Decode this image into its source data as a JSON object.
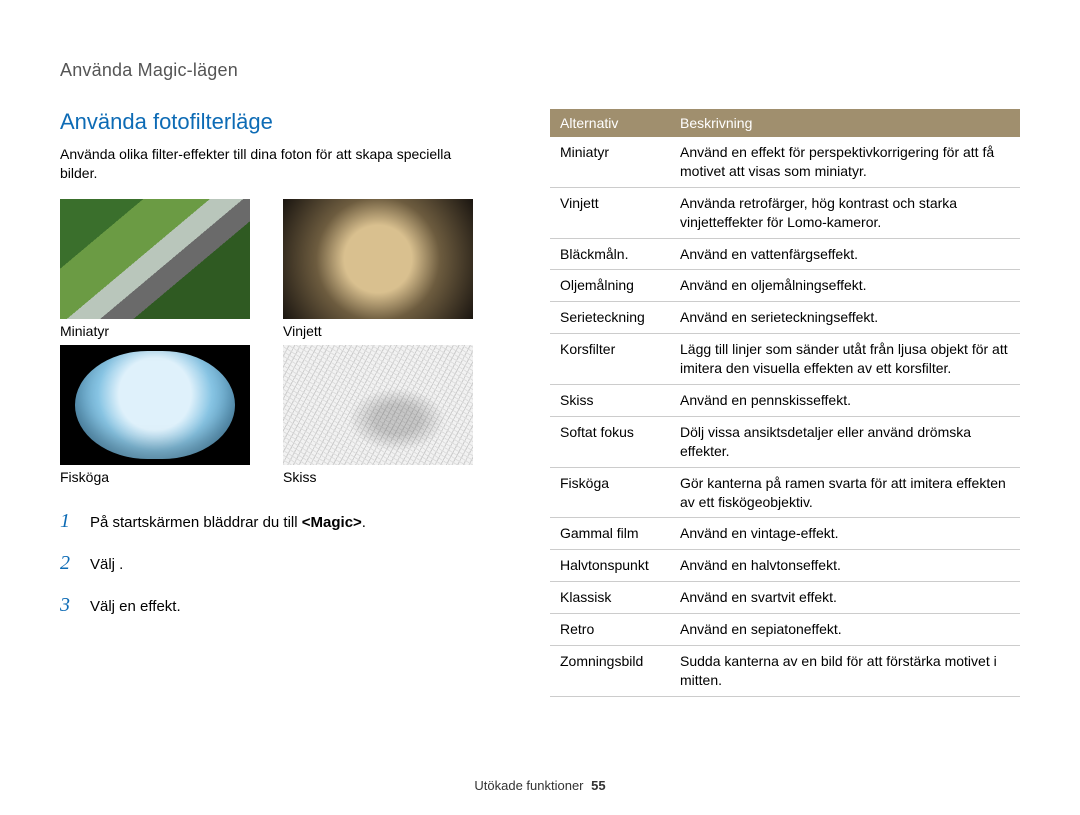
{
  "header": {
    "section": "Använda Magic-lägen"
  },
  "title": "Använda fotofilterläge",
  "intro": "Använda olika filter-effekter till dina foton för att skapa speciella bilder.",
  "thumbnails": [
    {
      "label": "Miniatyr"
    },
    {
      "label": "Vinjett"
    },
    {
      "label": "Fisköga"
    },
    {
      "label": "Skiss"
    }
  ],
  "steps": [
    {
      "num": "1",
      "prefix": "På startskärmen bläddrar du till ",
      "bold": "<Magic>",
      "suffix": "."
    },
    {
      "num": "2",
      "prefix": "Välj",
      "bold": "",
      "suffix": " ."
    },
    {
      "num": "3",
      "prefix": "Välj en effekt.",
      "bold": "",
      "suffix": ""
    }
  ],
  "table": {
    "headers": {
      "col1": "Alternativ",
      "col2": "Beskrivning"
    },
    "rows": [
      {
        "opt": "Miniatyr",
        "desc": "Använd en effekt för perspektivkorrigering för att få motivet att visas som miniatyr."
      },
      {
        "opt": "Vinjett",
        "desc": "Använda retrofärger, hög kontrast och starka vinjetteffekter för Lomo-kameror."
      },
      {
        "opt": "Bläckmåln.",
        "desc": "Använd en vattenfärgseffekt."
      },
      {
        "opt": "Oljemålning",
        "desc": "Använd en oljemålningseffekt."
      },
      {
        "opt": "Serieteckning",
        "desc": "Använd en serieteckningseffekt."
      },
      {
        "opt": "Korsfilter",
        "desc": "Lägg till linjer som sänder utåt från ljusa objekt för att imitera den visuella effekten av ett korsfilter."
      },
      {
        "opt": "Skiss",
        "desc": "Använd en pennskisseffekt."
      },
      {
        "opt": "Softat fokus",
        "desc": "Dölj vissa ansiktsdetaljer eller använd drömska effekter."
      },
      {
        "opt": "Fisköga",
        "desc": "Gör kanterna på ramen svarta för att imitera effekten av ett fiskögeobjektiv."
      },
      {
        "opt": "Gammal film",
        "desc": "Använd en vintage-effekt."
      },
      {
        "opt": "Halvtonspunkt",
        "desc": "Använd en halvtonseffekt."
      },
      {
        "opt": "Klassisk",
        "desc": "Använd en svartvit effekt."
      },
      {
        "opt": "Retro",
        "desc": "Använd en sepiatoneffekt."
      },
      {
        "opt": "Zomningsbild",
        "desc": "Sudda kanterna av en bild för att förstärka motivet i mitten."
      }
    ]
  },
  "footer": {
    "text": "Utökade funktioner",
    "page": "55"
  }
}
